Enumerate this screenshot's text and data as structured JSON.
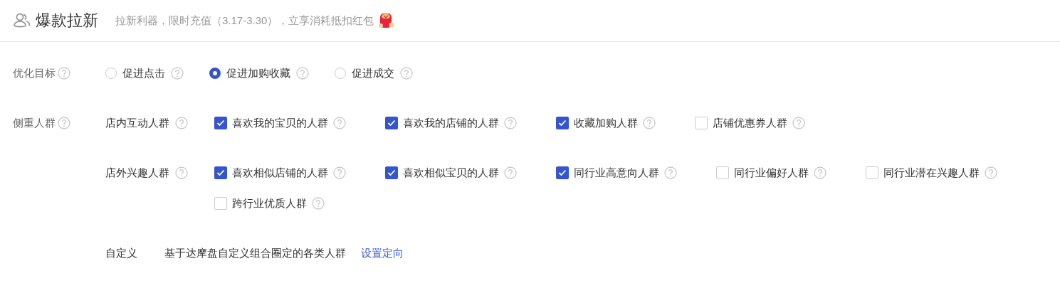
{
  "header": {
    "title": "爆款拉新",
    "hint": "拉新利器，限时充值（3.17-3.30），立享消耗抵扣红包"
  },
  "goal": {
    "label": "优化目标",
    "options": [
      {
        "label": "促进点击",
        "selected": false
      },
      {
        "label": "促进加购收藏",
        "selected": true
      },
      {
        "label": "促进成交",
        "selected": false
      }
    ]
  },
  "audience": {
    "label": "侧重人群",
    "groups": [
      {
        "label": "店内互动人群",
        "options": [
          {
            "label": "喜欢我的宝贝的人群",
            "checked": true
          },
          {
            "label": "喜欢我的店铺的人群",
            "checked": true
          },
          {
            "label": "收藏加购人群",
            "checked": true
          },
          {
            "label": "店铺优惠券人群",
            "checked": false
          }
        ]
      },
      {
        "label": "店外兴趣人群",
        "options": [
          {
            "label": "喜欢相似店铺的人群",
            "checked": true
          },
          {
            "label": "喜欢相似宝贝的人群",
            "checked": true
          },
          {
            "label": "同行业高意向人群",
            "checked": true
          },
          {
            "label": "同行业偏好人群",
            "checked": false
          },
          {
            "label": "同行业潜在兴趣人群",
            "checked": false
          },
          {
            "label": "跨行业优质人群",
            "checked": false
          }
        ]
      }
    ],
    "custom": {
      "label": "自定义",
      "description": "基于达摩盘自定义组合圈定的各类人群",
      "link": "设置定向"
    }
  }
}
